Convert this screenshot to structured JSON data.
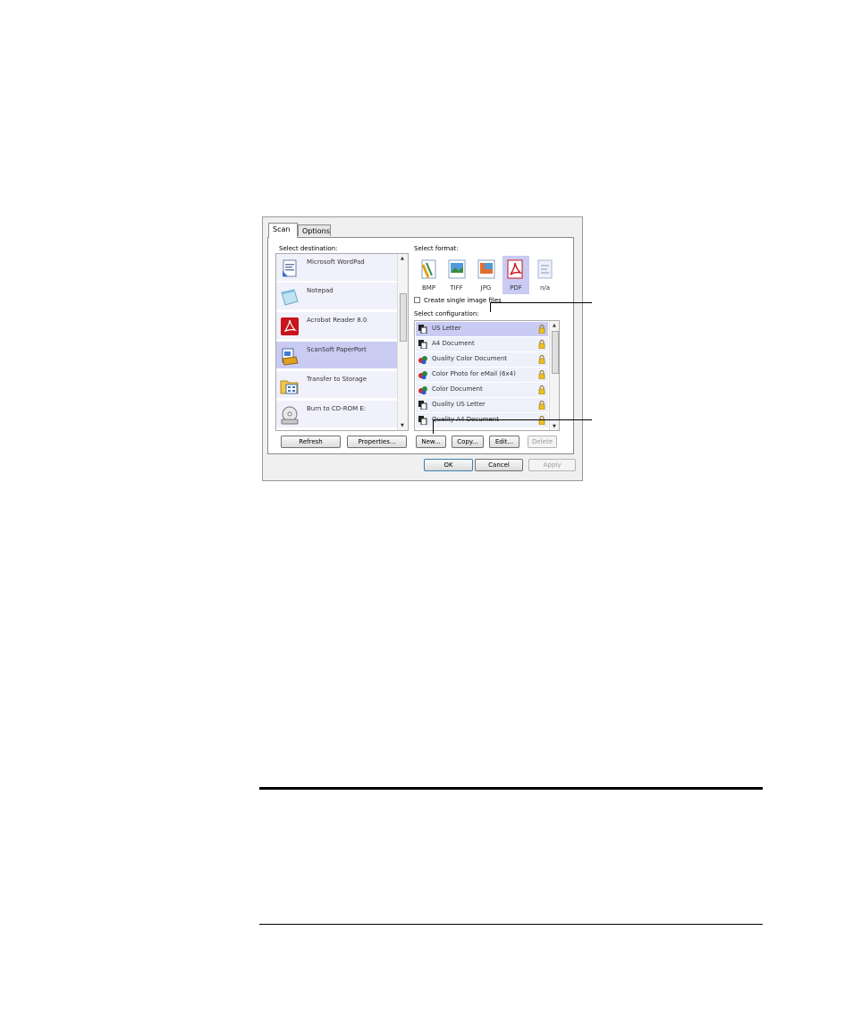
{
  "dialog": {
    "tabs": [
      {
        "label": "Scan"
      },
      {
        "label": "Options"
      }
    ],
    "destination": {
      "label": "Select destination:",
      "items": [
        {
          "label": "Microsoft WordPad",
          "icon": "wordpad-icon"
        },
        {
          "label": "Notepad",
          "icon": "notepad-icon"
        },
        {
          "label": "Acrobat Reader 8.0",
          "icon": "acrobat-icon"
        },
        {
          "label": "ScanSoft PaperPort",
          "icon": "paperport-icon",
          "selected": true
        },
        {
          "label": "Transfer to Storage",
          "icon": "storage-icon"
        },
        {
          "label": "Burn to CD-ROM  E:",
          "icon": "cd-icon"
        }
      ]
    },
    "format": {
      "label": "Select format:",
      "items": [
        {
          "label": "BMP",
          "icon": "bmp-icon"
        },
        {
          "label": "TIFF",
          "icon": "tiff-icon"
        },
        {
          "label": "JPG",
          "icon": "jpg-icon"
        },
        {
          "label": "PDF",
          "icon": "pdf-icon",
          "selected": true
        },
        {
          "label": "n/a",
          "icon": "text-format-icon"
        }
      ]
    },
    "single_image": {
      "label": "Create single image files",
      "checked": false
    },
    "configuration": {
      "label": "Select configuration:",
      "items": [
        {
          "label": "US Letter",
          "icon": "bw-document-icon",
          "selected": true
        },
        {
          "label": "A4 Document",
          "icon": "bw-document-icon"
        },
        {
          "label": "Quality Color Document",
          "icon": "color-document-icon"
        },
        {
          "label": "Color Photo for eMail (6x4)",
          "icon": "color-document-icon"
        },
        {
          "label": "Color Document",
          "icon": "color-document-icon"
        },
        {
          "label": "Quality US Letter",
          "icon": "bw-document-icon"
        },
        {
          "label": "Quality A4 Document",
          "icon": "bw-document-icon"
        }
      ]
    },
    "buttons": {
      "refresh": "Refresh",
      "properties": "Properties...",
      "new": "New...",
      "copy": "Copy...",
      "edit": "Edit...",
      "delete": "Delete",
      "ok": "OK",
      "cancel": "Cancel",
      "apply": "Apply"
    }
  },
  "colors": {
    "selection": "#c9cbf2",
    "item_bg": "#f1f1fb",
    "dialog_bg": "#f0f0f0"
  }
}
